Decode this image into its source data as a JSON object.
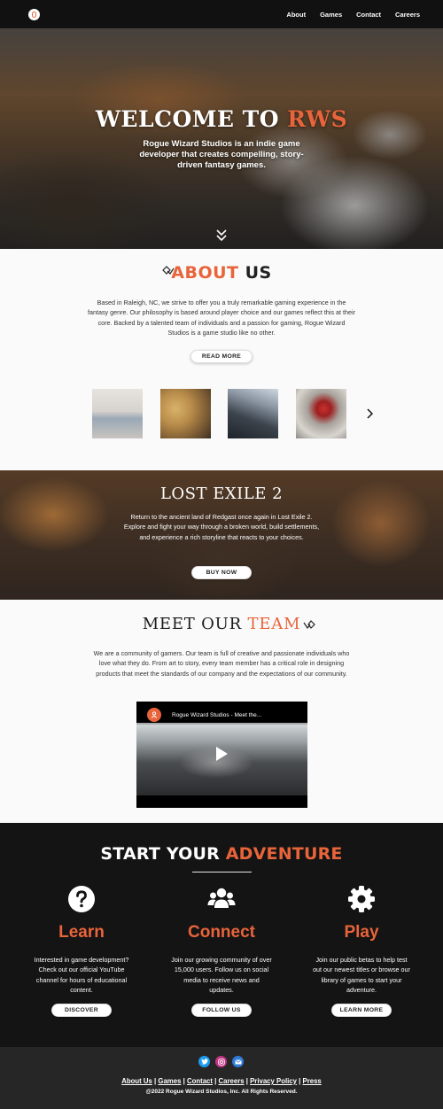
{
  "nav": {
    "links": [
      "About",
      "Games",
      "Contact",
      "Careers"
    ]
  },
  "hero": {
    "title_part1": "WELCOME TO ",
    "title_accent": "RWS",
    "subtitle": "Rogue Wizard Studios is an indie game developer that creates compelling, story-driven fantasy games."
  },
  "about": {
    "title_accent": "ABOUT",
    "title_rest": " US",
    "text": "Based in Raleigh, NC, we strive to offer you a truly remarkable gaming experience in the fantasy genre. Our philosophy is based around player choice and our games reflect this at their core. Backed by a talented team of individuals and a passion for gaming, Rogue Wizard Studios is a game studio like no other.",
    "button": "READ MORE"
  },
  "lost_exile": {
    "title": "LOST EXILE 2",
    "text": "Return to the ancient land of Redgast once again in Lost Exile 2. Explore and fight your way through a broken world, build settlements, and experience a rich storyline that reacts to your choices.",
    "button": "BUY NOW"
  },
  "team": {
    "title_part1": "MEET OUR ",
    "title_accent": "TEAM",
    "text": "We are a community of gamers. Our team is full of creative and passionate individuals who love what they do. From art to story, every team member has a critical role in designing products that meet the standards of our company and the expectations of our community.",
    "video_title": "Rogue Wizard Studios - Meet the..."
  },
  "adventure": {
    "title_part1": "START YOUR ",
    "title_accent": "ADVENTURE",
    "columns": [
      {
        "icon": "question-icon",
        "heading": "Learn",
        "text": "Interested in game development? Check out our official YouTube channel for hours of educational content.",
        "button": "DISCOVER"
      },
      {
        "icon": "users-icon",
        "heading": "Connect",
        "text": "Join our growing community of over 15,000 users. Follow us on social media to receive news and updates.",
        "button": "FOLLOW US"
      },
      {
        "icon": "gear-icon",
        "heading": "Play",
        "text": "Join our public betas to help test out our newest titles or browse our library of games to start your adventure.",
        "button": "LEARN MORE"
      }
    ]
  },
  "footer": {
    "social": [
      {
        "icon": "twitter-icon",
        "color": "#1d9bf0"
      },
      {
        "icon": "instagram-icon",
        "color": "#c13584"
      },
      {
        "icon": "email-icon",
        "color": "#2f7bd6"
      }
    ],
    "links": [
      "About Us",
      "Games",
      "Contact",
      "Careers",
      "Privacy Policy",
      "Press"
    ],
    "separator": "|",
    "copyright": "@2022 Rogue Wizard Studios, Inc. All Rights Reserved."
  },
  "colors": {
    "accent": "#e8643a",
    "dark": "#141414",
    "footer": "#262626"
  }
}
